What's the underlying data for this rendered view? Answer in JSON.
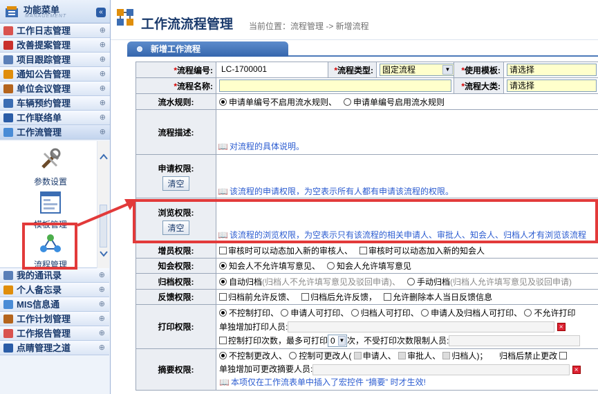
{
  "sidebar": {
    "title": "功能菜单",
    "subtitle": "MANAGEMENT",
    "collapse_glyph": "«",
    "menu_top": [
      {
        "label": "工作日志管理",
        "icon": "journal-icon",
        "color": "#d9534f"
      },
      {
        "label": "改善提案管理",
        "icon": "proposal-icon",
        "color": "#c9302c"
      },
      {
        "label": "项目跟踪管理",
        "icon": "project-icon",
        "color": "#5a7fb8"
      },
      {
        "label": "通知公告管理",
        "icon": "notice-icon",
        "color": "#e08e0b"
      },
      {
        "label": "单位会议管理",
        "icon": "meeting-icon",
        "color": "#b5651d"
      },
      {
        "label": "车辆预约管理",
        "icon": "car-icon",
        "color": "#3b6db3"
      },
      {
        "label": "工作联络单",
        "icon": "contact-icon",
        "color": "#2b5da7"
      },
      {
        "label": "工作流管理",
        "icon": "workflow-icon",
        "color": "#4a8cd6"
      }
    ],
    "sub_items": [
      {
        "label": "参数设置",
        "icon": "tools-icon"
      },
      {
        "label": "模板管理",
        "icon": "template-icon"
      },
      {
        "label": "流程管理",
        "icon": "flow-icon"
      }
    ],
    "partial_sub": "流程管理",
    "menu_bottom": [
      {
        "label": "我的通讯录",
        "icon": "addressbook-icon",
        "color": "#5a7fb8"
      },
      {
        "label": "个人备忘录",
        "icon": "memo-icon",
        "color": "#e08e0b"
      },
      {
        "label": "MIS信息通",
        "icon": "mis-icon",
        "color": "#4a8cd6"
      },
      {
        "label": "工作计划管理",
        "icon": "plan-icon",
        "color": "#b5651d"
      },
      {
        "label": "工作报告管理",
        "icon": "report-icon",
        "color": "#d9534f"
      },
      {
        "label": "点睛管理之道",
        "icon": "idea-icon",
        "color": "#2b5da7"
      }
    ]
  },
  "header": {
    "title": "工作流流程管理",
    "breadcrumb": "当前位置：流程管理 -> 新增流程"
  },
  "tab": {
    "label": "新增工作流程"
  },
  "form": {
    "flow_no_label": "*流程编号:",
    "flow_no_value": "LC-1700001",
    "flow_type_label": "*流程类型:",
    "flow_type_value": "固定流程",
    "template_label": "*使用模板:",
    "template_value": "请选择",
    "flow_name_label": "*流程名称:",
    "flow_name_value": "",
    "category_label": "*流程大类:",
    "category_value": "请选择",
    "serial_label": "流水规则:",
    "serial_opt1": "申请单编号不启用流水规则、",
    "serial_opt2": "申请单编号启用流水规则",
    "desc_label": "流程描述:",
    "desc_tip": "对流程的具体说明。",
    "apply_label": "申请权限:",
    "clear_button": "清空",
    "apply_tip": "该流程的申请权限，为空表示所有人都有申请该流程的权限。",
    "browse_label": "浏览权限:",
    "browse_tip": "该流程的浏览权限，为空表示只有该流程的相关申请人、审批人、知会人、归档人才有浏览该流程",
    "add_label": "增员权限:",
    "add_opt1": "审核时可以动态加入新的审核人、",
    "add_opt2": "审核时可以动态加入新的知会人",
    "notify_label": "知会权限:",
    "notify_opt1": "知会人不允许填写意见、",
    "notify_opt2": "知会人允许填写意见",
    "archive_label": "归档权限:",
    "archive_opt1": "自动归档",
    "archive_opt1_note": "(归档人不允许填写意见及驳回申请)、",
    "archive_opt2": "手动归档",
    "archive_opt2_note": "(归档人允许填写意见及驳回申请)",
    "feedback_label": "反馈权限:",
    "feedback_opt1": "归档前允许反馈、",
    "feedback_opt2": "归档后允许反馈，",
    "feedback_opt3": "允许删除本人当日反馈信息",
    "print_label": "打印权限:",
    "print_opts": [
      "不控制打印、",
      "申请人可打印、",
      "归档人可打印、",
      "申请人及归档人可打印、",
      "不允许打印"
    ],
    "print_extra_label": "单独增加打印人员:",
    "print_count_label": "控制打印次数，最多可打印",
    "print_count_value": "0",
    "print_count_suffix": "次，不受打印次数限制人员:",
    "summary_label": "摘要权限:",
    "summary_opt1": "不控制更改人、",
    "summary_opt2": "控制可更改人(",
    "summary_c1": "申请人、",
    "summary_c2": "审批人、",
    "summary_c3": "归档人",
    "summary_close": ")；",
    "summary_forbid": "归档后禁止更改",
    "summary_extra_label": "单独增加可更改摘要人员:",
    "summary_tip": "本项仅在工作流表单中插入了宏控件 “摘要” 时才生效!"
  },
  "colors": {
    "highlight": "#e23a3a",
    "tip": "#2a5bd0",
    "tab": "#3566ad"
  }
}
